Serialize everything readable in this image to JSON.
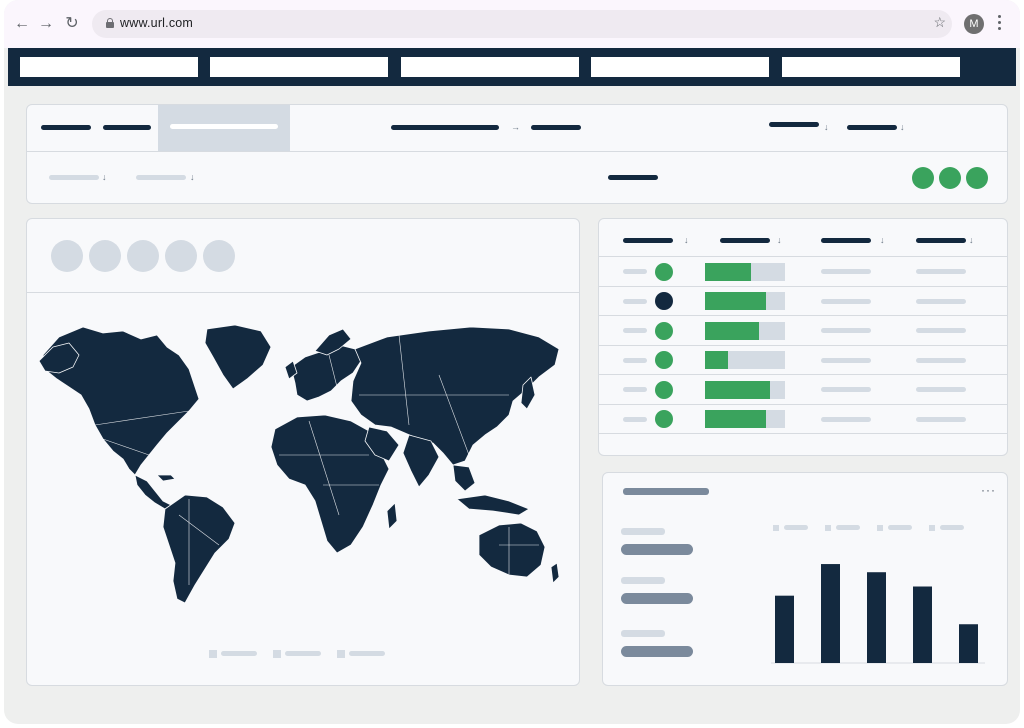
{
  "browser": {
    "url": "www.url.com",
    "avatar_initial": "M",
    "icons": [
      "back-icon",
      "forward-icon",
      "reload-icon",
      "lock-icon",
      "star-icon",
      "more-vert-icon"
    ]
  },
  "colors": {
    "navy": "#13293f",
    "green": "#3aa35d",
    "light_grey": "#d4dbe3",
    "mid_grey": "#7b8a9c",
    "panel": "#f8f9fb",
    "page_bg": "#eeefee"
  },
  "table": {
    "rows": [
      {
        "status": "green",
        "progress": 0.57
      },
      {
        "status": "navy",
        "progress": 0.76
      },
      {
        "status": "green",
        "progress": 0.68
      },
      {
        "status": "green",
        "progress": 0.29
      },
      {
        "status": "green",
        "progress": 0.81
      },
      {
        "status": "green",
        "progress": 0.76
      }
    ]
  },
  "chart_data": {
    "type": "bar",
    "categories": [
      "",
      "",
      "",
      "",
      ""
    ],
    "values": [
      66,
      97,
      89,
      75,
      38
    ],
    "ylim": [
      0,
      100
    ],
    "grid": false,
    "legend": "top-right"
  }
}
